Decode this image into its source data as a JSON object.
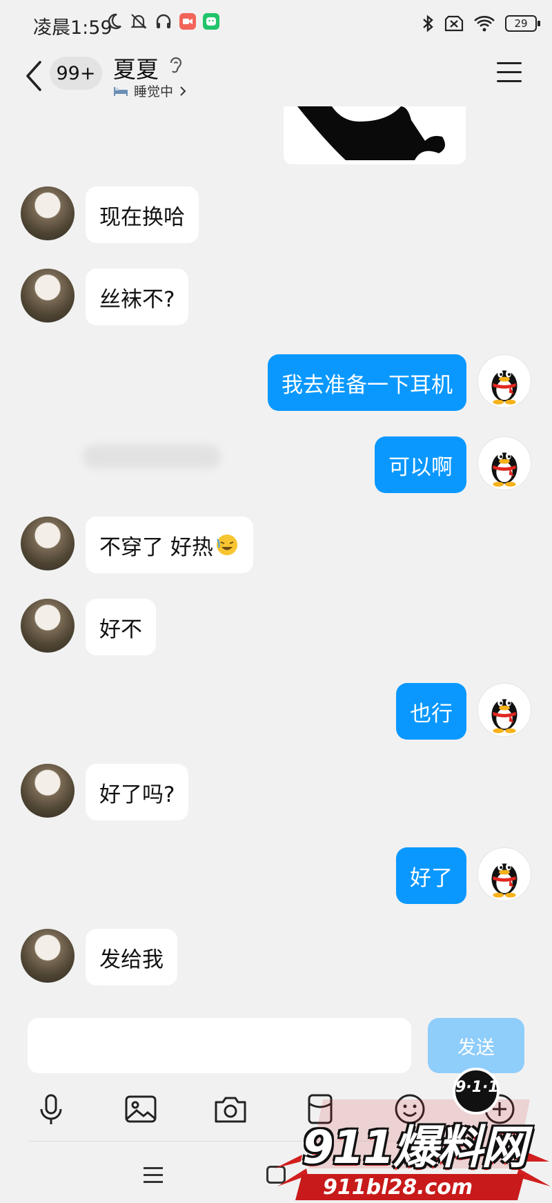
{
  "status_bar": {
    "time": "凌晨1:59",
    "battery": "29"
  },
  "header": {
    "unread_badge": "99+",
    "contact_name": "夏夏",
    "status_text": "睡觉中"
  },
  "messages": [
    {
      "side": "left",
      "text": "现在换哈"
    },
    {
      "side": "left",
      "text": "丝袜不?"
    },
    {
      "side": "right",
      "text": "我去准备一下耳机"
    },
    {
      "side": "right",
      "text": "可以啊"
    },
    {
      "side": "left",
      "text": "不穿了 好热"
    },
    {
      "side": "left",
      "text": "好不"
    },
    {
      "side": "right",
      "text": "也行"
    },
    {
      "side": "left",
      "text": "好了吗?"
    },
    {
      "side": "right",
      "text": "好了"
    },
    {
      "side": "left",
      "text": "发给我"
    }
  ],
  "input": {
    "value": "",
    "send_label": "发送"
  },
  "toolbar": [
    "microphone-icon",
    "image-icon",
    "camera-icon",
    "red-packet-icon",
    "emoji-icon",
    "plus-icon"
  ],
  "watermark": {
    "badge": "9·1·1",
    "main": "911爆料网",
    "url": "911bl28.com"
  },
  "colors": {
    "bubble_right": "#0a98ff",
    "send_disabled": "#8fcdfb",
    "background": "#f1f1f1"
  }
}
